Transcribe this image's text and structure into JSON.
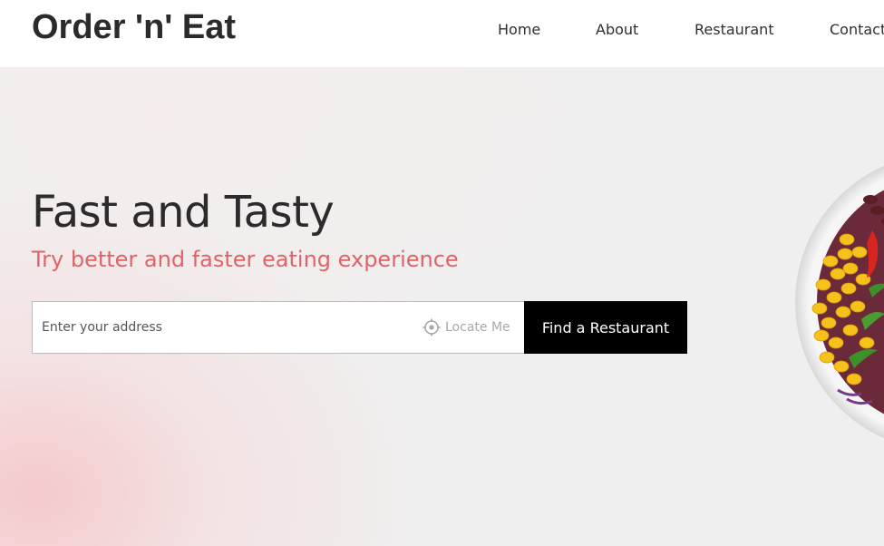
{
  "header": {
    "logo": "Order 'n' Eat",
    "nav": [
      "Home",
      "About",
      "Restaurant",
      "Contact"
    ]
  },
  "hero": {
    "title": "Fast and Tasty",
    "subtitle": "Try better and faster eating experience",
    "search": {
      "placeholder": "Enter your address",
      "value": "",
      "locate_label": "Locate Me",
      "locate_icon": "crosshair-icon"
    },
    "cta_label": "Find a Restaurant",
    "image_subject": "salad-bowl-image"
  },
  "colors": {
    "text": "#2b2b2b",
    "accent": "#e0636a",
    "button_bg": "#000000",
    "button_text": "#ffffff",
    "hero_bg": "#f0efef"
  }
}
